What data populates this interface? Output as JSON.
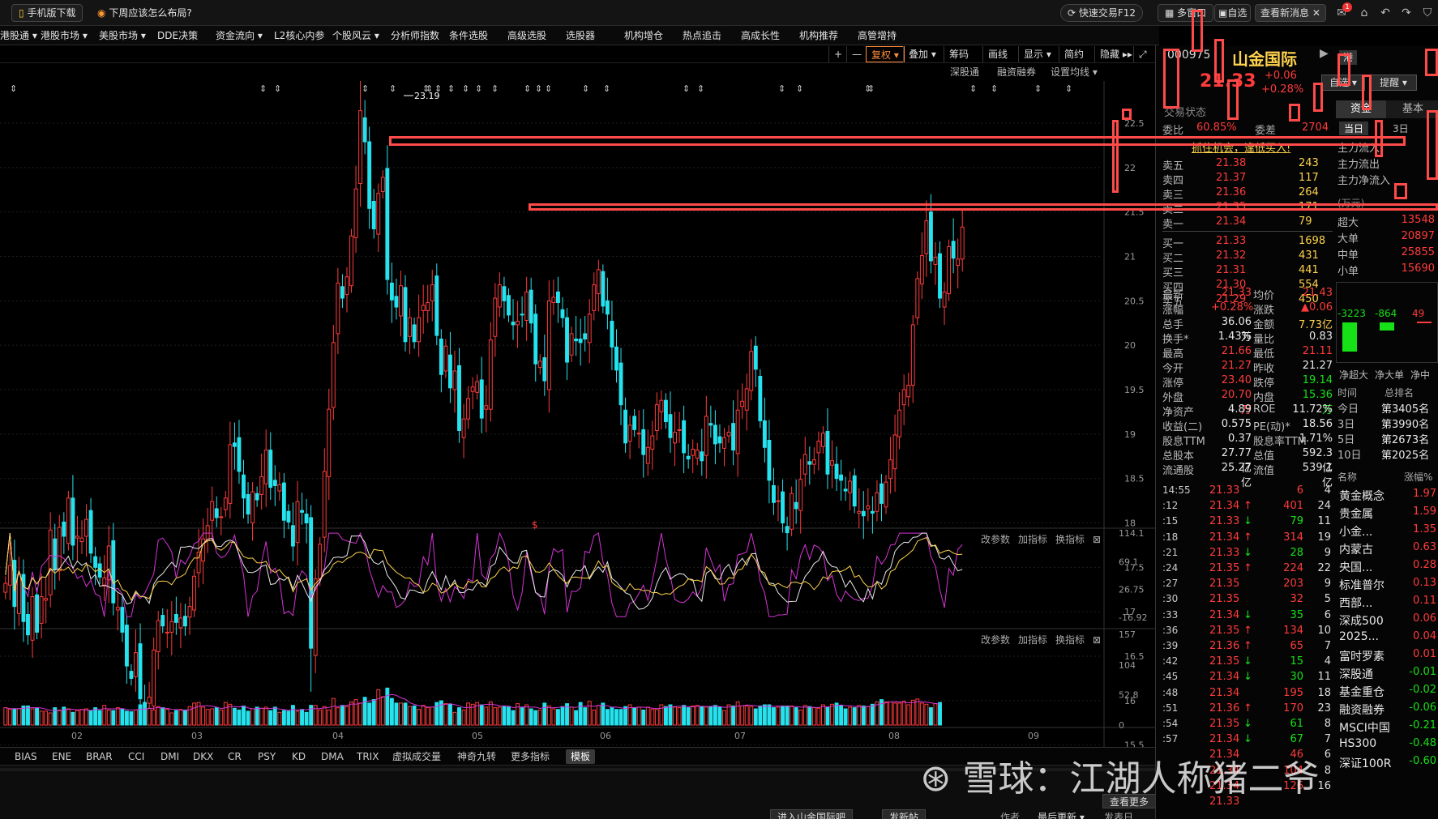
{
  "colors": {
    "up": "#ff3b3b",
    "down": "#25e3ee",
    "ma5": "#e8e8e8",
    "ma10": "#ffd34d",
    "ma20": "#d633d6",
    "highlight": "#ff4a4a"
  },
  "topbar": {
    "mobile_download": "手机版下载",
    "promo": "下周应该怎么布局?",
    "quick_trade": "快速交易F12",
    "multi_window": "多窗口",
    "self_select": "自选",
    "view_news": "查看新消息",
    "news_badge": "1"
  },
  "menu": [
    "港股通",
    "港股市场",
    "美股市场",
    "DDE决策",
    "资金流向",
    "L2核心内参",
    "个股风云",
    "分析师指数",
    "条件选股",
    "高级选股",
    "选股器",
    "机构增仓",
    "热点追击",
    "高成长性",
    "机构推荐",
    "高管增持"
  ],
  "chart_toolbar": {
    "plus": "+",
    "minus": "—",
    "fuquan": "复权",
    "overlay": "叠加",
    "chips": "筹码",
    "draw": "画线",
    "display": "显示",
    "simple": "简约",
    "hide": "隐藏"
  },
  "chart_sub": {
    "sgt": "深股通",
    "margin": "融资融券",
    "ma_setting": "设置均线"
  },
  "chart_data": [
    {
      "type": "candlestick",
      "title": "",
      "yticks": [
        15.0,
        15.5,
        16.0,
        16.5,
        17.0,
        17.5,
        18.0,
        18.5,
        19.0,
        19.5,
        20.0,
        20.5,
        21.0,
        21.5,
        22.0,
        22.5
      ],
      "xticks": [
        "02",
        "03",
        "04",
        "05",
        "06",
        "07",
        "08",
        "09"
      ],
      "annotations": [
        "23.19",
        "$"
      ],
      "close": [
        17.32,
        17.52,
        17.06,
        17.42,
        16.89,
        16.74,
        17.17,
        16.77,
        17.17,
        17.15,
        17.92,
        17.48,
        17.95,
        17.85,
        18.28,
        17.75,
        17.85,
        17.83,
        18.04,
        17.66,
        17.5,
        17.39,
        17.38,
        17.74,
        17.1,
        17.05,
        16.77,
        16.39,
        16.25,
        16.54,
        16.02,
        15.93,
        16.04,
        16.57,
        16.9,
        16.84,
        16.77,
        16.89,
        16.88,
        16.93,
        16.84,
        17.06,
        17.4,
        17.67,
        17.82,
        17.97,
        18.24,
        18.06,
        18.07,
        18.28,
        18.88,
        18.86,
        18.58,
        18.28,
        18.1,
        18.35,
        18.26,
        18.52,
        18.82,
        18.4,
        18.42,
        18.43,
        18.03,
        18.01,
        17.74,
        18.24,
        18.12,
        18.0,
        16.59,
        17.37,
        17.76,
        18.58,
        19.28,
        20.03,
        20.7,
        20.53,
        20.77,
        21.23,
        21.76,
        22.64,
        22.29,
        21.54,
        21.31,
        21.71,
        21.89,
        20.74,
        20.51,
        20.43,
        20.67,
        20.04,
        20.31,
        20.04,
        20.31,
        20.45,
        20.48,
        20.68,
        20.11,
        19.67,
        19.99,
        19.52,
        19.71,
        19.04,
        19.17,
        19.4,
        19.53,
        19.59,
        19.18,
        19.32,
        20.06,
        20.53,
        20.68,
        20.5,
        20.34,
        20.23,
        20.27,
        20.34,
        20.6,
        20.25,
        19.79,
        19.82,
        19.6,
        20.5,
        20.54,
        20.48,
        20.31,
        19.81,
        20.13,
        20.05,
        20.03,
        20.07,
        20.35,
        20.68,
        20.85,
        20.44,
        20.35,
        19.98,
        19.72,
        19.33,
        18.9,
        19.1,
        19.05,
        19.01,
        18.77,
        18.85,
        18.98,
        19.33,
        19.38,
        19.14,
        18.96,
        19.02,
        19.05,
        18.79,
        18.72,
        18.83,
        18.82,
        18.7,
        19.2,
        19.1,
        18.89,
        18.9,
        18.96,
        19.02,
        18.82,
        19.27,
        19.37,
        19.51,
        19.93,
        19.73,
        19.15,
        18.85,
        18.48,
        18.23,
        18.25,
        18.0,
        17.89,
        18.33,
        18.16,
        18.49,
        18.77,
        18.66,
        18.71,
        18.92,
        19.01,
        18.55,
        18.7,
        18.5,
        18.48,
        18.36,
        18.47,
        18.19,
        18.13,
        18.08,
        18.19,
        18.11,
        18.34,
        18.22,
        18.46,
        18.71,
        18.99,
        19.27,
        19.5,
        19.55,
        20.23,
        20.75,
        21.01,
        21.4,
        20.95,
        20.99,
        20.53,
        20.6,
        21.11,
        20.98,
        20.97,
        21.33
      ],
      "volume": [
        30,
        27,
        28,
        28,
        33,
        33,
        28,
        29,
        24,
        24,
        21,
        30,
        26,
        31,
        28,
        22,
        25,
        27,
        28,
        25,
        30,
        25,
        34,
        26,
        25,
        30,
        28,
        24,
        23,
        26,
        35,
        30,
        29,
        26,
        32,
        30,
        27,
        21,
        25,
        27,
        26,
        32,
        38,
        39,
        31,
        27,
        28,
        30,
        26,
        39,
        36,
        29,
        26,
        33,
        24,
        28,
        31,
        29,
        31,
        25,
        31,
        22,
        25,
        24,
        34,
        24,
        27,
        22,
        34,
        34,
        26,
        32,
        26,
        46,
        30,
        34,
        32,
        40,
        44,
        38,
        48,
        38,
        44,
        61,
        49,
        64,
        46,
        38,
        38,
        38,
        32,
        33,
        27,
        34,
        30,
        31,
        39,
        42,
        37,
        36,
        22,
        30,
        26,
        38,
        36,
        39,
        35,
        31,
        40,
        30,
        31,
        33,
        31,
        25,
        37,
        30,
        35,
        28,
        25,
        26,
        38,
        33,
        28,
        27,
        32,
        37,
        31,
        25,
        39,
        30,
        41,
        26,
        34,
        38,
        27,
        30,
        27,
        27,
        32,
        35,
        30,
        31,
        26,
        31,
        27,
        27,
        35,
        32,
        35,
        31,
        30,
        34,
        30,
        33,
        34,
        32,
        31,
        32,
        34,
        31,
        25,
        35,
        33,
        40,
        33,
        33,
        32,
        28,
        33,
        35,
        35,
        30,
        31,
        33,
        33,
        33,
        30,
        26,
        34,
        32,
        30,
        29,
        35,
        31,
        36,
        38,
        34,
        28,
        31,
        30,
        34,
        33,
        32,
        36,
        40,
        44,
        40,
        40,
        38,
        38,
        41,
        35,
        43,
        45,
        38,
        36,
        30,
        37,
        39
      ]
    },
    {
      "type": "line",
      "title": "",
      "yticks": [
        114.1,
        69.1,
        26.75,
        -16.92
      ]
    },
    {
      "type": "bar",
      "title": "",
      "yticks": [
        157.0,
        104.0,
        52.8,
        0.0
      ]
    }
  ],
  "indicator_tabs": [
    "BIAS",
    "ENE",
    "BRAR",
    "CCI",
    "DMI",
    "DKX",
    "CR",
    "PSY",
    "KD",
    "DMA",
    "TRIX",
    "虚拟成交量",
    "神奇九转",
    "更多指标",
    "模板"
  ],
  "panel_links": {
    "edit": "改参数",
    "add": "加指标",
    "switch": "换指标"
  },
  "bottom": {
    "see_more": "查看更多",
    "enter_bar": "进入山金国际吧",
    "post": "发新帖",
    "author": "作者",
    "latest": "最后更新",
    "time_label": "发表日"
  },
  "stock": {
    "code": "000975",
    "name": "山金国际",
    "price": "21.33",
    "change": "+0.06",
    "pct": "+0.28%",
    "status": "交易状态",
    "market": "港",
    "tab_self": "自选",
    "tab_alert": "提醒",
    "weibi_label": "委比",
    "weibi": "60.85%",
    "weicha_label": "委差",
    "weicha": "2704",
    "note": "抓住机会，逢低买入!",
    "asks": [
      {
        "label": "卖五",
        "price": "21.38",
        "vol": "243"
      },
      {
        "label": "卖四",
        "price": "21.37",
        "vol": "117"
      },
      {
        "label": "卖三",
        "price": "21.36",
        "vol": "264"
      },
      {
        "label": "卖二",
        "price": "21.35",
        "vol": "171"
      },
      {
        "label": "卖一",
        "price": "21.34",
        "vol": "79"
      }
    ],
    "bids": [
      {
        "label": "买一",
        "price": "21.33",
        "vol": "1698"
      },
      {
        "label": "买二",
        "price": "21.32",
        "vol": "431"
      },
      {
        "label": "买三",
        "price": "21.31",
        "vol": "441"
      },
      {
        "label": "买四",
        "price": "21.30",
        "vol": "554"
      },
      {
        "label": "买五",
        "price": "21.29",
        "vol": "450"
      }
    ],
    "stats": [
      [
        "最新",
        "21.33",
        "均价",
        "21.43"
      ],
      [
        "涨幅",
        "+0.28%",
        "涨跌",
        "▲0.06"
      ],
      [
        "总手",
        "36.06万",
        "金额",
        "7.73亿"
      ],
      [
        "换手*",
        "1.43%",
        "量比",
        "0.83"
      ],
      [
        "最高",
        "21.66",
        "最低",
        "21.11"
      ],
      [
        "今开",
        "21.27",
        "昨收",
        "21.27"
      ],
      [
        "涨停",
        "23.40",
        "跌停",
        "19.14"
      ],
      [
        "外盘",
        "20.70万",
        "内盘",
        "15.36万"
      ],
      [
        "净资产",
        "4.89",
        "ROE",
        "11.72%"
      ],
      [
        "收益(二)",
        "0.575",
        "PE(动)*",
        "18.56"
      ],
      [
        "股息TTM",
        "0.37",
        "股息率TTM",
        "1.71%"
      ],
      [
        "总股本",
        "27.77亿",
        "总值",
        "592.3亿"
      ],
      [
        "流通股",
        "25.27亿",
        "流值",
        "539.1亿"
      ]
    ],
    "ticks": [
      [
        "14:55",
        "21.33",
        "",
        "6",
        "4"
      ],
      [
        ":12",
        "21.34",
        "↑",
        "401",
        "24"
      ],
      [
        ":15",
        "21.33",
        "↓",
        "79",
        "11"
      ],
      [
        ":18",
        "21.34",
        "↑",
        "314",
        "19"
      ],
      [
        ":21",
        "21.33",
        "↓",
        "28",
        "9"
      ],
      [
        ":24",
        "21.35",
        "↑",
        "224",
        "22"
      ],
      [
        ":27",
        "21.35",
        "",
        "203",
        "9"
      ],
      [
        ":30",
        "21.35",
        "",
        "32",
        "5"
      ],
      [
        ":33",
        "21.34",
        "↓",
        "35",
        "6"
      ],
      [
        ":36",
        "21.35",
        "↑",
        "134",
        "10"
      ],
      [
        ":39",
        "21.36",
        "↑",
        "65",
        "7"
      ],
      [
        ":42",
        "21.35",
        "↓",
        "15",
        "4"
      ],
      [
        ":45",
        "21.34",
        "↓",
        "30",
        "11"
      ],
      [
        ":48",
        "21.34",
        "",
        "195",
        "18"
      ],
      [
        ":51",
        "21.36",
        "↑",
        "170",
        "23"
      ],
      [
        ":54",
        "21.35",
        "↓",
        "61",
        "8"
      ],
      [
        ":57",
        "21.34",
        "↓",
        "67",
        "7"
      ],
      [
        "",
        "21.34",
        "",
        "46",
        "6"
      ],
      [
        "",
        "21.34",
        "",
        "104",
        "8"
      ],
      [
        "",
        "21.34",
        "",
        "126",
        "16"
      ],
      [
        "",
        "21.33",
        "",
        "",
        ""
      ]
    ]
  },
  "fund": {
    "tabs": [
      "资金",
      "基本"
    ],
    "periods": [
      "当日",
      "3日"
    ],
    "rows": [
      [
        "主力流入",
        ""
      ],
      [
        "主力流出",
        ""
      ],
      [
        "主力净流入",
        ""
      ]
    ],
    "unit": "(万元)",
    "flows": [
      [
        "超大",
        "13548"
      ],
      [
        "大单",
        "20897"
      ],
      [
        "中单",
        "25855"
      ],
      [
        "小单",
        "15690"
      ]
    ],
    "bars": [
      {
        "label": "-3223",
        "value": -3223
      },
      {
        "label": "-864",
        "value": -864
      },
      {
        "label": "49",
        "value": 49
      }
    ],
    "bar_labels": [
      "净超大",
      "净大单",
      "净中"
    ],
    "rank_head": [
      "时间",
      "总排名"
    ],
    "ranks": [
      [
        "今日",
        "第3405名"
      ],
      [
        "3日",
        "第3990名"
      ],
      [
        "5日",
        "第2673名"
      ],
      [
        "10日",
        "第2025名"
      ]
    ],
    "sector_head": [
      "名称",
      "涨幅%"
    ],
    "sectors": [
      [
        "黄金概念",
        "1.97"
      ],
      [
        "贵金属",
        "1.59"
      ],
      [
        "小金...",
        "1.35"
      ],
      [
        "内蒙古",
        "0.63"
      ],
      [
        "央国...",
        "0.28"
      ],
      [
        "标准普尔",
        "0.13"
      ],
      [
        "西部...",
        "0.11"
      ],
      [
        "深成500",
        "0.06"
      ],
      [
        "2025...",
        "0.04"
      ],
      [
        "富时罗素",
        "0.01"
      ],
      [
        "深股通",
        "-0.01"
      ],
      [
        "基金重仓",
        "-0.02"
      ],
      [
        "融资融券",
        "-0.06"
      ],
      [
        "MSCI中国",
        "-0.21"
      ],
      [
        "HS300",
        "-0.48"
      ],
      [
        "深证100R",
        "-0.60"
      ]
    ]
  },
  "watermark": "雪球：江湖人称猪二爷"
}
